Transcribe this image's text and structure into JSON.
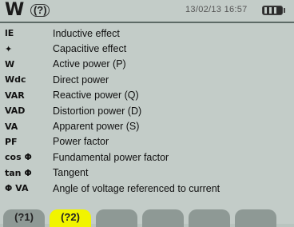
{
  "header": {
    "app_icon": "W",
    "help_icon": "(?)",
    "datetime": "13/02/13 16:57",
    "battery": "battery-icon"
  },
  "legend": [
    {
      "symbol": "lE",
      "label": "Inductive effect"
    },
    {
      "symbol": "✦",
      "label": "Capacitive effect"
    },
    {
      "symbol": "W",
      "label": "Active power (P)"
    },
    {
      "symbol": "Wdc",
      "label": "Direct power"
    },
    {
      "symbol": "VAR",
      "label": "Reactive power (Q)"
    },
    {
      "symbol": "VAD",
      "label": "Distortion power (D)"
    },
    {
      "symbol": "VA",
      "label": "Apparent power (S)"
    },
    {
      "symbol": "PF",
      "label": "Power factor"
    },
    {
      "symbol": "cos Φ",
      "label": "Fundamental power factor"
    },
    {
      "symbol": "tan Φ",
      "label": "Tangent"
    },
    {
      "symbol": "Φ VA",
      "label": "Angle of voltage referenced to current"
    }
  ],
  "tabs": [
    {
      "label": "(?1)",
      "active": false
    },
    {
      "label": "(?2)",
      "active": true
    },
    {
      "label": "",
      "active": false
    },
    {
      "label": "",
      "active": false
    },
    {
      "label": "",
      "active": false
    },
    {
      "label": "",
      "active": false
    }
  ],
  "colors": {
    "screen_bg": "#c3ccc8",
    "tab_inactive": "#8e9995",
    "tab_active": "#f1f400"
  }
}
